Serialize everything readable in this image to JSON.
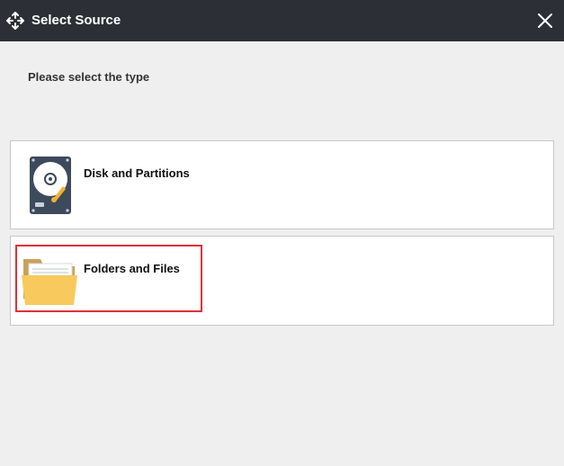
{
  "window": {
    "title": "Select Source",
    "app_icon": "backup-arrows-icon",
    "close_icon": "close-icon"
  },
  "prompt": "Please select the type",
  "options": [
    {
      "label": "Disk and Partitions",
      "icon": "hard-disk-icon",
      "highlighted": false
    },
    {
      "label": "Folders and Files",
      "icon": "folder-icon",
      "highlighted": true
    }
  ],
  "colors": {
    "titlebar": "#2c3036",
    "background": "#efefef",
    "highlight": "#e0303a",
    "folder": "#f8c95c"
  }
}
